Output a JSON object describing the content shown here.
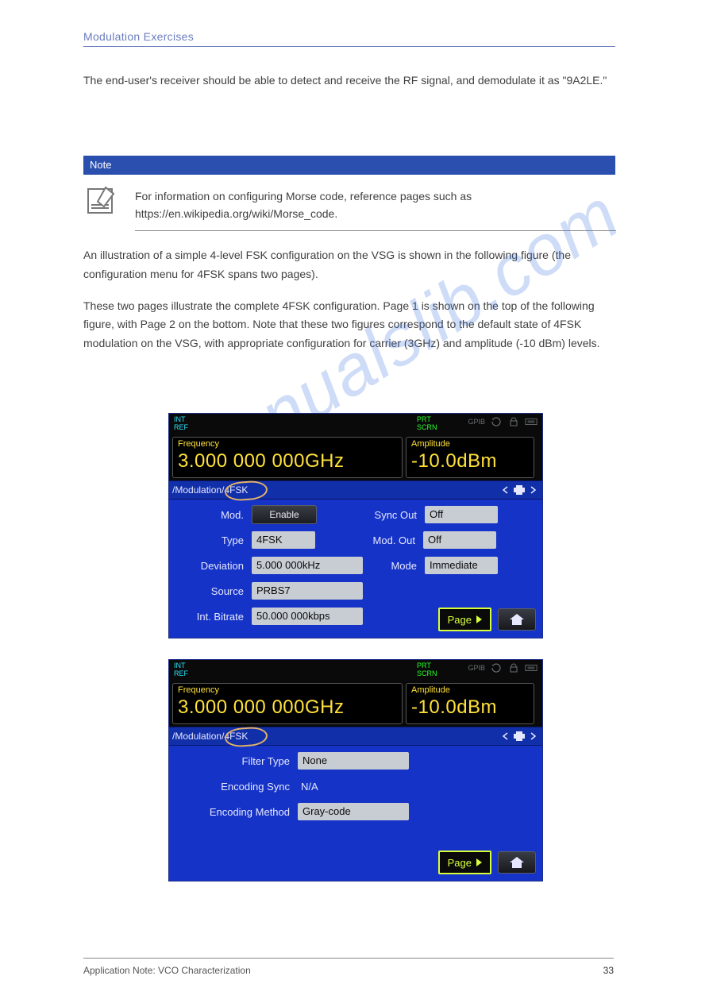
{
  "header": {
    "title": "Modulation Exercises"
  },
  "intro": "The end-user's receiver should be able to detect and receive the RF signal, and demodulate it as \"9A2LE.\"",
  "note": {
    "heading": "Note",
    "text": "For information on configuring Morse code, reference pages such as https://en.wikipedia.org/wiki/Morse_code."
  },
  "body2": {
    "p1": "An illustration of a simple 4-level FSK configuration on the VSG is shown in the following figure (the configuration menu for 4FSK spans two pages).",
    "p2": "These two pages illustrate the complete 4FSK configuration. Page 1 is shown on the top of the following figure, with Page 2 on the bottom. Note that these two figures correspond to the default state of 4FSK modulation on the VSG, with appropriate configuration for carrier (3GHz) and amplitude (-10 dBm) levels."
  },
  "watermark": "manualslib.com",
  "panels": {
    "status": {
      "intref_line1": "INT",
      "intref_line2": "REF",
      "prt_line1": "PRT",
      "prt_line2": "SCRN",
      "gpib": "GPIB"
    },
    "readouts": {
      "freq_label": "Frequency",
      "freq_value": "3.000 000 000GHz",
      "amp_label": "Amplitude",
      "amp_value": "-10.0dBm"
    },
    "breadcrumb": {
      "slash": "/",
      "seg1": "Modulation",
      "seg2": "4FSK"
    },
    "panel1": {
      "mod_label": "Mod.",
      "mod_value": "Enable",
      "type_label": "Type",
      "type_value": "4FSK",
      "deviation_label": "Deviation",
      "deviation_value": "5.000 000kHz",
      "source_label": "Source",
      "source_value": "PRBS7",
      "bitrate_label": "Int. Bitrate",
      "bitrate_value": "50.000 000kbps",
      "syncout_label": "Sync Out",
      "syncout_value": "Off",
      "modout_label": "Mod. Out",
      "modout_value": "Off",
      "mode_label": "Mode",
      "mode_value": "Immediate"
    },
    "panel2": {
      "filter_label": "Filter Type",
      "filter_value": "None",
      "encsync_label": "Encoding Sync",
      "encsync_value": "N/A",
      "encmethod_label": "Encoding Method",
      "encmethod_value": "Gray-code"
    },
    "page_btn": "Page"
  },
  "footer": {
    "left": "Application Note: VCO Characterization",
    "right": "33"
  }
}
